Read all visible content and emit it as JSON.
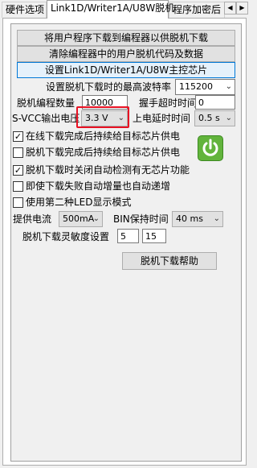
{
  "tabs": [
    {
      "label": "硬件选项"
    },
    {
      "label": "Link1D/Writer1A/U8W脱机"
    },
    {
      "label": "程序加密后"
    }
  ],
  "tab_scroll": {
    "left": "◀",
    "right": "▶"
  },
  "buttons": {
    "download_user_program": "将用户程序下载到编程器以供脱机下载",
    "clear_user_offline": "清除编程器中的用户脱机代码及数据",
    "set_main_chip": "设置Link1D/Writer1A/U8W主控芯片",
    "offline_help": "脱机下载帮助"
  },
  "baud": {
    "label": "设置脱机下载时的最高波特率",
    "value": "115200"
  },
  "program_count": {
    "label": "脱机编程数量",
    "value": "10000"
  },
  "handshake_timeout": {
    "label": "握手超时时间",
    "value": "0"
  },
  "svcc": {
    "label": "S-VCC输出电压",
    "value": "3.3 V"
  },
  "power_delay": {
    "label": "上电延时时间",
    "value": "0.5 s"
  },
  "checkboxes": [
    {
      "label": "在线下载完成后持续给目标芯片供电",
      "checked": true,
      "mark": "✓"
    },
    {
      "label": "脱机下载完成后持续给目标芯片供电",
      "checked": false,
      "mark": ""
    },
    {
      "label": "脱机下载时关闭自动检测有无芯片功能",
      "checked": true,
      "mark": "✓"
    },
    {
      "label": "即使下载失败自动增量也自动递增",
      "checked": false,
      "mark": ""
    },
    {
      "label": "使用第二种LED显示模式",
      "checked": false,
      "mark": ""
    }
  ],
  "supply_current": {
    "label": "提供电流",
    "value": "500mA"
  },
  "bin_hold": {
    "label": "BIN保持时间",
    "value": "40 ms"
  },
  "sensitivity": {
    "label": "脱机下载灵敏度设置",
    "value1": "5",
    "value2": "15"
  },
  "icons": {
    "power": "power-icon",
    "dropdown": "chevron-down-icon"
  },
  "colors": {
    "highlight": "#e81123",
    "power_green": "#62b43c",
    "focus_blue": "#0078d7"
  }
}
